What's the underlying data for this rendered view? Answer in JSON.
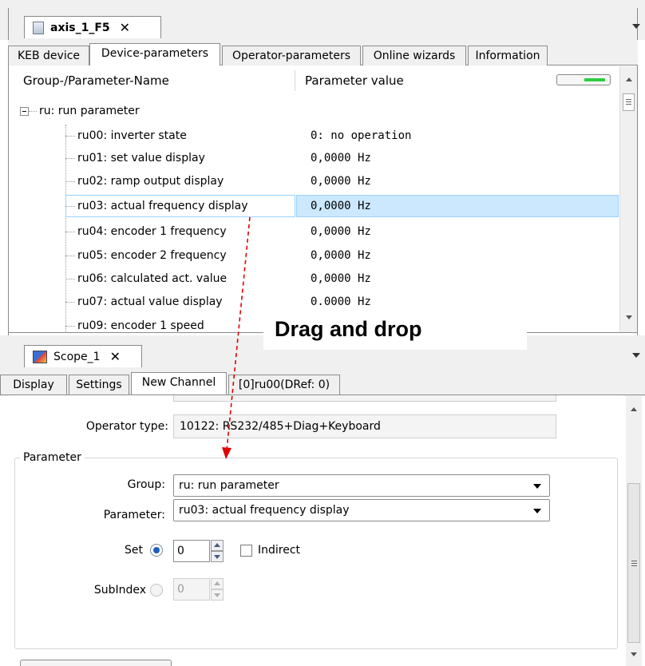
{
  "top_panel": {
    "doc_tab_title": "axis_1_F5",
    "tabs": [
      "KEB device",
      "Device-parameters",
      "Operator-parameters",
      "Online wizards",
      "Information"
    ],
    "columns": {
      "name": "Group-/Parameter-Name",
      "value": "Parameter value"
    },
    "group_label": "ru: run parameter",
    "rows": [
      {
        "name": "ru00: inverter state",
        "value": "0: no operation"
      },
      {
        "name": "ru01: set value display",
        "value": "0,0000 Hz"
      },
      {
        "name": "ru02: ramp output display",
        "value": "0,0000 Hz"
      },
      {
        "name": "ru03: actual frequency display",
        "value": "0,0000 Hz"
      },
      {
        "name": "ru04: encoder 1 frequency",
        "value": "0,0000 Hz"
      },
      {
        "name": "ru05: encoder 2 frequency",
        "value": "0,0000 Hz"
      },
      {
        "name": "ru06: calculated act. value",
        "value": "0,0000 Hz"
      },
      {
        "name": "ru07: actual value display",
        "value": "0.0000 Hz"
      },
      {
        "name": "ru09: encoder 1 speed",
        "value": ""
      }
    ],
    "selected_row": 3
  },
  "annotation": {
    "text": "Drag and drop",
    "arrow_color": "#e00000"
  },
  "bottom_panel": {
    "doc_tab_title": "Scope_1",
    "tabs": [
      "Display",
      "Settings",
      "New Channel",
      "[0]ru00(DRef: 0)"
    ],
    "operator_type_label": "Operator type:",
    "operator_type_value": "10122: RS232/485+Diag+Keyboard",
    "parameter_group_title": "Parameter",
    "group_label": "Group:",
    "group_value": "ru: run parameter",
    "parameter_label": "Parameter:",
    "parameter_value": "ru03: actual frequency display",
    "set_label": "Set",
    "set_value": "0",
    "indirect_label": "Indirect",
    "subindex_label": "SubIndex",
    "subindex_value": "0"
  },
  "colors": {
    "selection_bg": "#cce8ff",
    "selection_border": "#99d1ff",
    "indicator_green": "#2ecc40"
  }
}
